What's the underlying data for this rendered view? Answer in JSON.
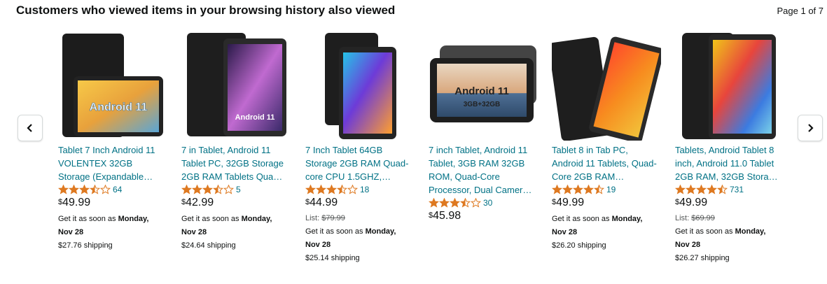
{
  "header": {
    "title": "Customers who viewed items in your browsing history also viewed",
    "page_indicator": "Page 1 of 7"
  },
  "colors": {
    "link": "#007185",
    "star": "#de7921",
    "text": "#0f1111",
    "muted": "#565959"
  },
  "products": [
    {
      "title": "Tablet 7 Inch Android 11 VOLENTEX 32GB Storage (Expandable…",
      "rating": 3.5,
      "reviews": "64",
      "price_symbol": "$",
      "price": "49.99",
      "list_label": "",
      "list_price": "",
      "delivery_prefix": "Get it as soon as",
      "delivery_date": "Monday, Nov 28",
      "shipping": "$27.76 shipping",
      "screen_label": "Android 11"
    },
    {
      "title": "7 in Tablet, Android 11 Tablet PC, 32GB Storage 2GB RAM Tablets Qua…",
      "rating": 3.5,
      "reviews": "5",
      "price_symbol": "$",
      "price": "42.99",
      "list_label": "",
      "list_price": "",
      "delivery_prefix": "Get it as soon as",
      "delivery_date": "Monday, Nov 28",
      "shipping": "$24.64 shipping",
      "screen_label": "Android 11"
    },
    {
      "title": "7 Inch Tablet 64GB Storage 2GB RAM Quad-core CPU 1.5GHZ,…",
      "rating": 3.5,
      "reviews": "18",
      "price_symbol": "$",
      "price": "44.99",
      "list_label": "List:",
      "list_price": "$79.99",
      "delivery_prefix": "Get it as soon as",
      "delivery_date": "Monday, Nov 28",
      "shipping": "$25.14 shipping",
      "screen_label": ""
    },
    {
      "title": "7 inch Tablet, Android 11 Tablet, 3GB RAM 32GB ROM, Quad-Core Processor, Dual Camer…",
      "rating": 3.5,
      "reviews": "30",
      "price_symbol": "$",
      "price": "45.98",
      "list_label": "",
      "list_price": "",
      "delivery_prefix": "",
      "delivery_date": "",
      "shipping": "",
      "screen_label": "Android 11",
      "screen_sub": "3GB+32GB"
    },
    {
      "title": "Tablet 8 in Tab PC, Android 11 Tablets, Quad-Core 2GB RAM…",
      "rating": 4.5,
      "reviews": "19",
      "price_symbol": "$",
      "price": "49.99",
      "list_label": "",
      "list_price": "",
      "delivery_prefix": "Get it as soon as",
      "delivery_date": "Monday, Nov 28",
      "shipping": "$26.20 shipping",
      "screen_label": ""
    },
    {
      "title": "Tablets, Android Tablet 8 inch, Android 11.0 Tablet 2GB RAM, 32GB Stora…",
      "rating": 4.5,
      "reviews": "731",
      "price_symbol": "$",
      "price": "49.99",
      "list_label": "List:",
      "list_price": "$69.99",
      "delivery_prefix": "Get it as soon as",
      "delivery_date": "Monday, Nov 28",
      "shipping": "$26.27 shipping",
      "screen_label": ""
    }
  ]
}
